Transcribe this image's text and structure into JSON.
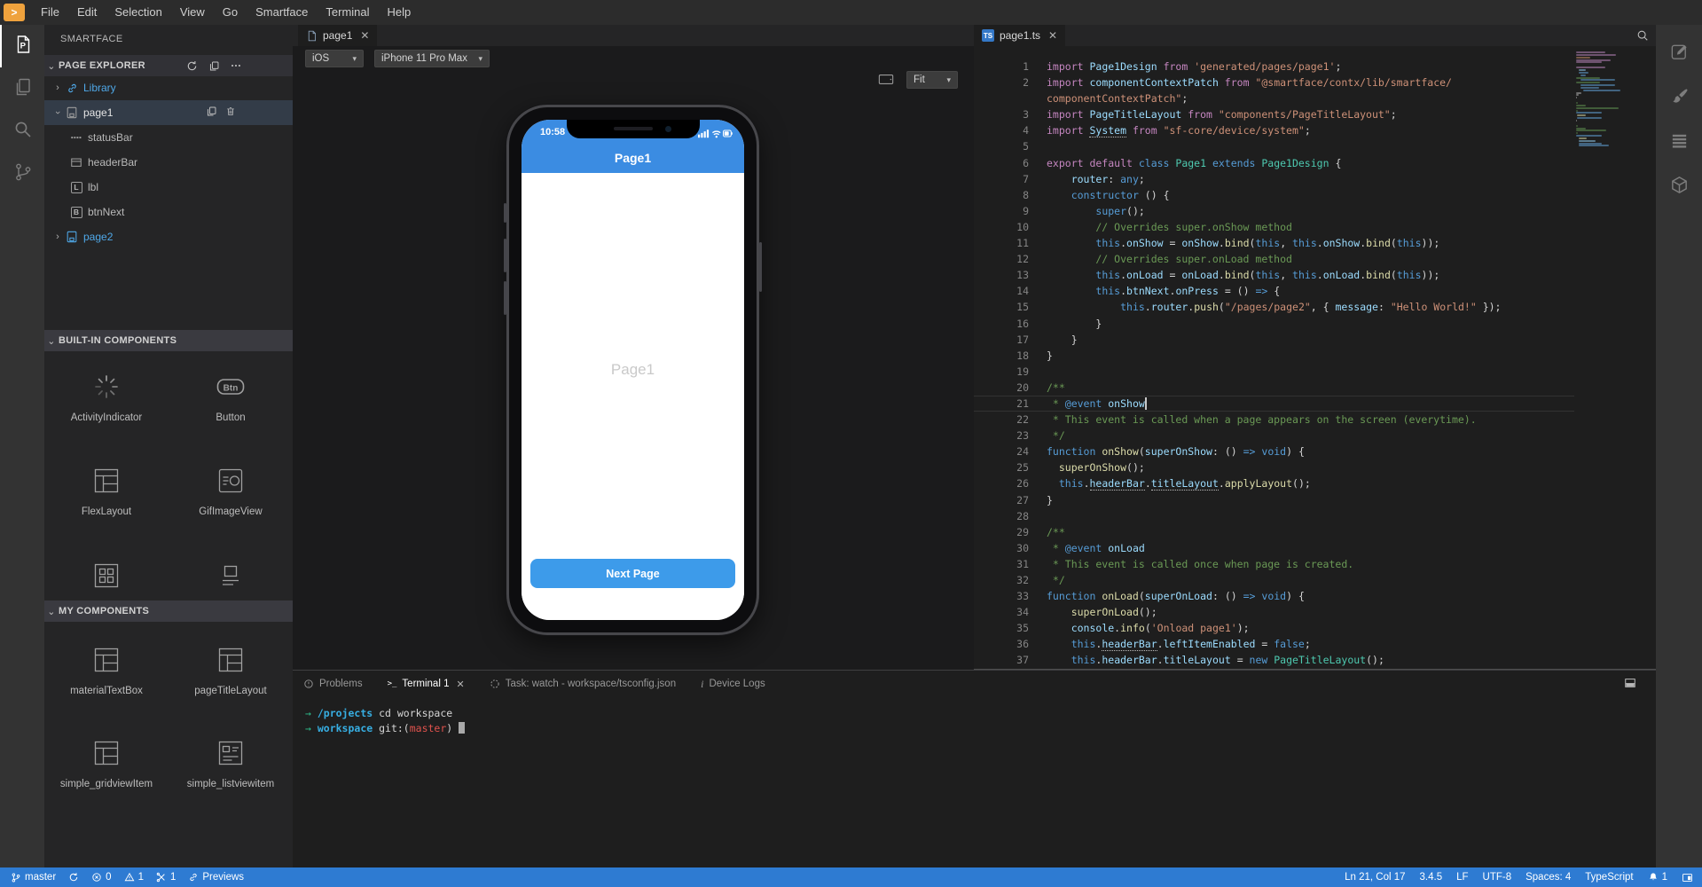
{
  "menubar": {
    "logo_glyph": ">",
    "items": [
      "File",
      "Edit",
      "Selection",
      "View",
      "Go",
      "Smartface",
      "Terminal",
      "Help"
    ]
  },
  "activity_left": [
    {
      "name": "smartface-explorer",
      "icon": "filep",
      "active": true
    },
    {
      "name": "pages",
      "icon": "pages",
      "active": false
    },
    {
      "name": "search",
      "icon": "search",
      "active": false
    },
    {
      "name": "source-control",
      "icon": "git",
      "active": false
    }
  ],
  "activity_right": [
    {
      "name": "design-editor",
      "icon": "pencilsq"
    },
    {
      "name": "theme-brush",
      "icon": "brush"
    },
    {
      "name": "properties-list",
      "icon": "list"
    },
    {
      "name": "modules-cube",
      "icon": "cube"
    }
  ],
  "sidebar": {
    "title": "SMARTFACE",
    "explorer_label": "PAGE EXPLORER",
    "tree": [
      {
        "label": "Library",
        "icon": "chain",
        "blue": true,
        "expanded": false,
        "chevron": true
      },
      {
        "label": "page1",
        "icon": "page",
        "selected": true,
        "expanded": true,
        "chevron": true,
        "children": [
          {
            "label": "statusBar",
            "icon": "statusbar"
          },
          {
            "label": "headerBar",
            "icon": "headerbar"
          },
          {
            "label": "lbl",
            "icon": "lbox"
          },
          {
            "label": "btnNext",
            "icon": "bbox"
          }
        ]
      },
      {
        "label": "page2",
        "icon": "page",
        "blue": true,
        "expanded": false,
        "chevron": true
      }
    ],
    "sections": [
      {
        "label": "BUILT-IN COMPONENTS",
        "items": [
          {
            "label": "ActivityIndicator",
            "ic": "spinner"
          },
          {
            "label": "Button",
            "ic": "btn"
          },
          {
            "label": "FlexLayout",
            "ic": "flex"
          },
          {
            "label": "GifImageView",
            "ic": "gif"
          },
          {
            "label": "",
            "ic": "grid"
          },
          {
            "label": "",
            "ic": "image"
          }
        ]
      },
      {
        "label": "MY COMPONENTS",
        "items": [
          {
            "label": "materialTextBox",
            "ic": "flex"
          },
          {
            "label": "pageTitleLayout",
            "ic": "flex"
          },
          {
            "label": "simple_gridviewItem",
            "ic": "flex"
          },
          {
            "label": "simple_listviewitem",
            "ic": "listitem"
          }
        ]
      }
    ]
  },
  "design": {
    "tab_label": "page1",
    "toolbar": {
      "os": "iOS",
      "device": "iPhone 11 Pro Max",
      "zoom": "Fit"
    },
    "phone": {
      "time": "10:58",
      "header_title": "Page1",
      "label_text": "Page1",
      "button_label": "Next Page"
    }
  },
  "editor": {
    "tab_label": "page1.ts",
    "badge": "TS",
    "code": [
      {
        "n": "1",
        "t": [
          [
            "import ",
            "k"
          ],
          [
            "Page1Design",
            "v"
          ],
          [
            " from ",
            "k"
          ],
          [
            "'generated/pages/page1'",
            "s"
          ],
          [
            ";",
            "p"
          ]
        ]
      },
      {
        "n": "2",
        "t": [
          [
            "import ",
            "k"
          ],
          [
            "componentContextPatch",
            "v"
          ],
          [
            " from ",
            "k"
          ],
          [
            "\"@smartface/contx/lib/smartface/",
            "s"
          ]
        ]
      },
      {
        "n": "",
        "t": [
          [
            "componentContextPatch\"",
            "s"
          ],
          [
            ";",
            "p"
          ]
        ]
      },
      {
        "n": "3",
        "t": [
          [
            "import ",
            "k"
          ],
          [
            "PageTitleLayout",
            "v"
          ],
          [
            " from ",
            "k"
          ],
          [
            "\"components/PageTitleLayout\"",
            "s"
          ],
          [
            ";",
            "p"
          ]
        ]
      },
      {
        "n": "4",
        "t": [
          [
            "import ",
            "k"
          ],
          [
            "System",
            "v u"
          ],
          [
            " from ",
            "k"
          ],
          [
            "\"sf-core/device/system\"",
            "s"
          ],
          [
            ";",
            "p"
          ]
        ]
      },
      {
        "n": "5",
        "t": []
      },
      {
        "n": "6",
        "t": [
          [
            "export default ",
            "k"
          ],
          [
            "class ",
            "b"
          ],
          [
            "Page1",
            "t"
          ],
          [
            " extends ",
            "b"
          ],
          [
            "Page1Design",
            "t"
          ],
          [
            " {",
            "p"
          ]
        ]
      },
      {
        "n": "7",
        "t": [
          [
            "    ",
            "p"
          ],
          [
            "router",
            "v"
          ],
          [
            ": ",
            "p"
          ],
          [
            "any",
            "b"
          ],
          [
            ";",
            "p"
          ]
        ]
      },
      {
        "n": "8",
        "t": [
          [
            "    ",
            "p"
          ],
          [
            "constructor",
            "b"
          ],
          [
            " () {",
            "p"
          ]
        ]
      },
      {
        "n": "9",
        "t": [
          [
            "        ",
            "p"
          ],
          [
            "super",
            "b"
          ],
          [
            "();",
            "p"
          ]
        ]
      },
      {
        "n": "10",
        "t": [
          [
            "        // Overrides super.onShow method",
            "c"
          ]
        ]
      },
      {
        "n": "11",
        "t": [
          [
            "        ",
            "p"
          ],
          [
            "this",
            "b"
          ],
          [
            ".",
            "p"
          ],
          [
            "onShow",
            "v"
          ],
          [
            " = ",
            "p"
          ],
          [
            "onShow",
            "v"
          ],
          [
            ".",
            "p"
          ],
          [
            "bind",
            "f"
          ],
          [
            "(",
            "p"
          ],
          [
            "this",
            "b"
          ],
          [
            ", ",
            "p"
          ],
          [
            "this",
            "b"
          ],
          [
            ".",
            "p"
          ],
          [
            "onShow",
            "v"
          ],
          [
            ".",
            "p"
          ],
          [
            "bind",
            "f"
          ],
          [
            "(",
            "p"
          ],
          [
            "this",
            "b"
          ],
          [
            "));",
            "p"
          ]
        ]
      },
      {
        "n": "12",
        "t": [
          [
            "        // Overrides super.onLoad method",
            "c"
          ]
        ]
      },
      {
        "n": "13",
        "t": [
          [
            "        ",
            "p"
          ],
          [
            "this",
            "b"
          ],
          [
            ".",
            "p"
          ],
          [
            "onLoad",
            "v"
          ],
          [
            " = ",
            "p"
          ],
          [
            "onLoad",
            "v"
          ],
          [
            ".",
            "p"
          ],
          [
            "bind",
            "f"
          ],
          [
            "(",
            "p"
          ],
          [
            "this",
            "b"
          ],
          [
            ", ",
            "p"
          ],
          [
            "this",
            "b"
          ],
          [
            ".",
            "p"
          ],
          [
            "onLoad",
            "v"
          ],
          [
            ".",
            "p"
          ],
          [
            "bind",
            "f"
          ],
          [
            "(",
            "p"
          ],
          [
            "this",
            "b"
          ],
          [
            "));",
            "p"
          ]
        ]
      },
      {
        "n": "14",
        "t": [
          [
            "        ",
            "p"
          ],
          [
            "this",
            "b"
          ],
          [
            ".",
            "p"
          ],
          [
            "btnNext",
            "v"
          ],
          [
            ".",
            "p"
          ],
          [
            "onPress",
            "v"
          ],
          [
            " = () ",
            "p"
          ],
          [
            "=>",
            "b"
          ],
          [
            " {",
            "p"
          ]
        ]
      },
      {
        "n": "15",
        "t": [
          [
            "            ",
            "p"
          ],
          [
            "this",
            "b"
          ],
          [
            ".",
            "p"
          ],
          [
            "router",
            "v"
          ],
          [
            ".",
            "p"
          ],
          [
            "push",
            "f"
          ],
          [
            "(",
            "p"
          ],
          [
            "\"/pages/page2\"",
            "s"
          ],
          [
            ", { ",
            "p"
          ],
          [
            "message",
            "v"
          ],
          [
            ": ",
            "p"
          ],
          [
            "\"Hello World!\"",
            "s"
          ],
          [
            " });",
            "p"
          ]
        ]
      },
      {
        "n": "16",
        "t": [
          [
            "        }",
            "p"
          ]
        ]
      },
      {
        "n": "17",
        "t": [
          [
            "    }",
            "p"
          ]
        ]
      },
      {
        "n": "18",
        "t": [
          [
            "}",
            "p"
          ]
        ]
      },
      {
        "n": "19",
        "t": []
      },
      {
        "n": "20",
        "t": [
          [
            "/**",
            "c"
          ]
        ]
      },
      {
        "n": "21",
        "t": [
          [
            " * ",
            "c"
          ],
          [
            "@event",
            "dk"
          ],
          [
            " onShow",
            "dv"
          ]
        ],
        "cur": true
      },
      {
        "n": "22",
        "t": [
          [
            " * This event is called when a page appears on the screen (everytime).",
            "c"
          ]
        ]
      },
      {
        "n": "23",
        "t": [
          [
            " */",
            "c"
          ]
        ]
      },
      {
        "n": "24",
        "t": [
          [
            "function ",
            "b"
          ],
          [
            "onShow",
            "f"
          ],
          [
            "(",
            "p"
          ],
          [
            "superOnShow",
            "v"
          ],
          [
            ": () ",
            "p"
          ],
          [
            "=>",
            "b"
          ],
          [
            " ",
            "p"
          ],
          [
            "void",
            "b"
          ],
          [
            ") {",
            "p"
          ]
        ]
      },
      {
        "n": "25",
        "t": [
          [
            "  ",
            "p"
          ],
          [
            "superOnShow",
            "f"
          ],
          [
            "();",
            "p"
          ]
        ]
      },
      {
        "n": "26",
        "t": [
          [
            "  ",
            "p"
          ],
          [
            "this",
            "b"
          ],
          [
            ".",
            "p"
          ],
          [
            "headerBar",
            "v u"
          ],
          [
            ".",
            "p"
          ],
          [
            "titleLayout",
            "v u"
          ],
          [
            ".",
            "p"
          ],
          [
            "applyLayout",
            "f"
          ],
          [
            "();",
            "p"
          ]
        ]
      },
      {
        "n": "27",
        "t": [
          [
            "}",
            "p"
          ]
        ]
      },
      {
        "n": "28",
        "t": []
      },
      {
        "n": "29",
        "t": [
          [
            "/**",
            "c"
          ]
        ]
      },
      {
        "n": "30",
        "t": [
          [
            " * ",
            "c"
          ],
          [
            "@event",
            "dk"
          ],
          [
            " onLoad",
            "dv"
          ]
        ]
      },
      {
        "n": "31",
        "t": [
          [
            " * This event is called once when page is created.",
            "c"
          ]
        ]
      },
      {
        "n": "32",
        "t": [
          [
            " */",
            "c"
          ]
        ]
      },
      {
        "n": "33",
        "t": [
          [
            "function ",
            "b"
          ],
          [
            "onLoad",
            "f"
          ],
          [
            "(",
            "p"
          ],
          [
            "superOnLoad",
            "v"
          ],
          [
            ": () ",
            "p"
          ],
          [
            "=>",
            "b"
          ],
          [
            " ",
            "p"
          ],
          [
            "void",
            "b"
          ],
          [
            ") {",
            "p"
          ]
        ]
      },
      {
        "n": "34",
        "t": [
          [
            "    ",
            "p"
          ],
          [
            "superOnLoad",
            "f"
          ],
          [
            "();",
            "p"
          ]
        ]
      },
      {
        "n": "35",
        "t": [
          [
            "    ",
            "p"
          ],
          [
            "console",
            "v"
          ],
          [
            ".",
            "p"
          ],
          [
            "info",
            "f"
          ],
          [
            "(",
            "p"
          ],
          [
            "'Onload page1'",
            "s"
          ],
          [
            ");",
            "p"
          ]
        ]
      },
      {
        "n": "36",
        "t": [
          [
            "    ",
            "p"
          ],
          [
            "this",
            "b"
          ],
          [
            ".",
            "p"
          ],
          [
            "headerBar",
            "v u"
          ],
          [
            ".",
            "p"
          ],
          [
            "leftItemEnabled",
            "v"
          ],
          [
            " = ",
            "p"
          ],
          [
            "false",
            "b"
          ],
          [
            ";",
            "p"
          ]
        ]
      },
      {
        "n": "37",
        "t": [
          [
            "    ",
            "p"
          ],
          [
            "this",
            "b"
          ],
          [
            ".",
            "p"
          ],
          [
            "headerBar",
            "v u"
          ],
          [
            ".",
            "p"
          ],
          [
            "titleLayout",
            "v"
          ],
          [
            " = ",
            "p"
          ],
          [
            "new ",
            "b"
          ],
          [
            "PageTitleLayout",
            "t"
          ],
          [
            "();",
            "p"
          ]
        ]
      }
    ]
  },
  "panel": {
    "tabs": [
      {
        "label": "Problems",
        "icon": "problems",
        "active": false,
        "closable": false
      },
      {
        "label": "Terminal 1",
        "icon": "terminal",
        "active": true,
        "closable": true
      },
      {
        "label": "Task: watch - workspace/tsconfig.json",
        "icon": "spin",
        "active": false,
        "closable": false
      },
      {
        "label": "Device Logs",
        "icon": "infoi",
        "active": false,
        "closable": false
      }
    ],
    "terminal": [
      {
        "parts": [
          [
            "→",
            "g"
          ],
          [
            " /projects",
            "b"
          ],
          [
            " cd workspace",
            "w"
          ]
        ],
        "cursor": false
      },
      {
        "parts": [
          [
            "→",
            "g"
          ],
          [
            " workspace",
            "b"
          ],
          [
            " git:(",
            "w"
          ],
          [
            "master",
            "r"
          ],
          [
            ") ",
            "w"
          ]
        ],
        "cursor": true
      }
    ]
  },
  "statusbar": {
    "left": [
      {
        "name": "git-branch",
        "icon": "branch",
        "label": "master"
      },
      {
        "name": "sync",
        "icon": "sync",
        "label": ""
      },
      {
        "name": "errors",
        "icon": "error",
        "label": "0"
      },
      {
        "name": "warnings",
        "icon": "warning",
        "label": "1"
      },
      {
        "name": "tasks",
        "icon": "tools",
        "label": "1"
      },
      {
        "name": "previews",
        "icon": "link",
        "label": "Previews"
      }
    ],
    "right": [
      {
        "name": "cursor-position",
        "icon": "",
        "label": "Ln 21, Col 17"
      },
      {
        "name": "version",
        "icon": "",
        "label": "3.4.5"
      },
      {
        "name": "eol",
        "icon": "",
        "label": "LF"
      },
      {
        "name": "encoding",
        "icon": "",
        "label": "UTF-8"
      },
      {
        "name": "indentation",
        "icon": "",
        "label": "Spaces: 4"
      },
      {
        "name": "language",
        "icon": "",
        "label": "TypeScript"
      },
      {
        "name": "notifications",
        "icon": "bell",
        "label": "1"
      },
      {
        "name": "screen-share",
        "icon": "screen",
        "label": ""
      }
    ]
  },
  "colors": {
    "phone_header_blue": "#3b8ce2",
    "phone_button_blue": "#3d9bea",
    "statusbar_blue": "#2e7bd2",
    "link_blue": "#4fa8e8",
    "logo_orange": "#efa23d"
  }
}
